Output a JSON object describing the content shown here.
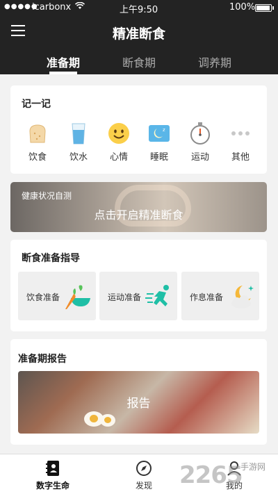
{
  "status_bar": {
    "carrier": "icarbonx",
    "time": "上午9:50",
    "battery": "100%"
  },
  "header": {
    "title": "精准断食"
  },
  "tabs": [
    {
      "label": "准备期",
      "active": true
    },
    {
      "label": "断食期",
      "active": false
    },
    {
      "label": "调养期",
      "active": false
    }
  ],
  "record_card": {
    "title": "记一记",
    "items": [
      {
        "label": "饮食",
        "icon": "bread-icon"
      },
      {
        "label": "饮水",
        "icon": "water-glass-icon"
      },
      {
        "label": "心情",
        "icon": "smiley-icon"
      },
      {
        "label": "睡眠",
        "icon": "sleep-icon"
      },
      {
        "label": "运动",
        "icon": "stopwatch-icon"
      },
      {
        "label": "其他",
        "icon": "more-icon"
      }
    ]
  },
  "banner": {
    "subtitle": "健康状况自测",
    "text": "点击开启精准断食"
  },
  "prep_card": {
    "title": "断食准备指导",
    "items": [
      {
        "label": "饮食准备",
        "icon": "vegetable-bowl-icon"
      },
      {
        "label": "运动准备",
        "icon": "running-icon"
      },
      {
        "label": "作息准备",
        "icon": "moon-cloud-icon"
      }
    ]
  },
  "report_card": {
    "title": "准备期报告",
    "label": "报告"
  },
  "bottom_nav": [
    {
      "label": "数字生命",
      "icon": "phone-book-icon",
      "active": true
    },
    {
      "label": "发现",
      "icon": "compass-icon",
      "active": false
    },
    {
      "label": "我的",
      "icon": "profile-icon",
      "active": false
    }
  ],
  "watermark": {
    "text": "2265",
    "sub": "手游网"
  },
  "colors": {
    "header_bg": "#232323",
    "page_bg": "#f2f2f2",
    "accent_green": "#1fbfa6",
    "accent_orange": "#f08c2a"
  }
}
